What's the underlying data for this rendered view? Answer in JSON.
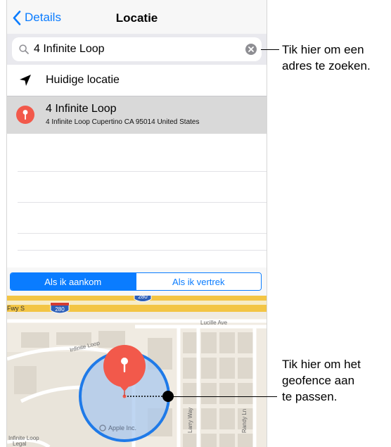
{
  "navbar": {
    "back_label": "Details",
    "title": "Locatie"
  },
  "search": {
    "value": "4 Infinite Loop",
    "icon": "search-icon",
    "clear_icon": "clear-icon"
  },
  "list": {
    "current_location_label": "Huidige locatie",
    "selected": {
      "title": "4 Infinite Loop",
      "subtitle": "4 Infinite Loop Cupertino CA 95014 United States"
    }
  },
  "segment": {
    "options": [
      "Als ik aankom",
      "Als ik vertrek"
    ],
    "selected_index": 0
  },
  "map": {
    "labels": {
      "freeway": "Fwy S",
      "route_shield_1": "280",
      "route_shield_2": "280",
      "lucille": "Lucille Ave",
      "infinite_loop_top": "Infinite Loop",
      "infinite_loop_bottom": "Infinite Loop",
      "apple_inc": "Apple Inc.",
      "larry_way": "Larry Way",
      "randy_ln": "Randy Ln",
      "legal": "Legal"
    }
  },
  "callouts": {
    "search": [
      "Tik hier om een",
      "adres te zoeken."
    ],
    "geofence": [
      "Tik hier om het",
      "geofence aan",
      "te passen."
    ]
  },
  "colors": {
    "accent": "#0a7cff",
    "pin": "#f2594b",
    "geofence_stroke": "#1f7ae8",
    "geofence_fill": "#a9c8ee",
    "freeway": "#f3c545"
  }
}
